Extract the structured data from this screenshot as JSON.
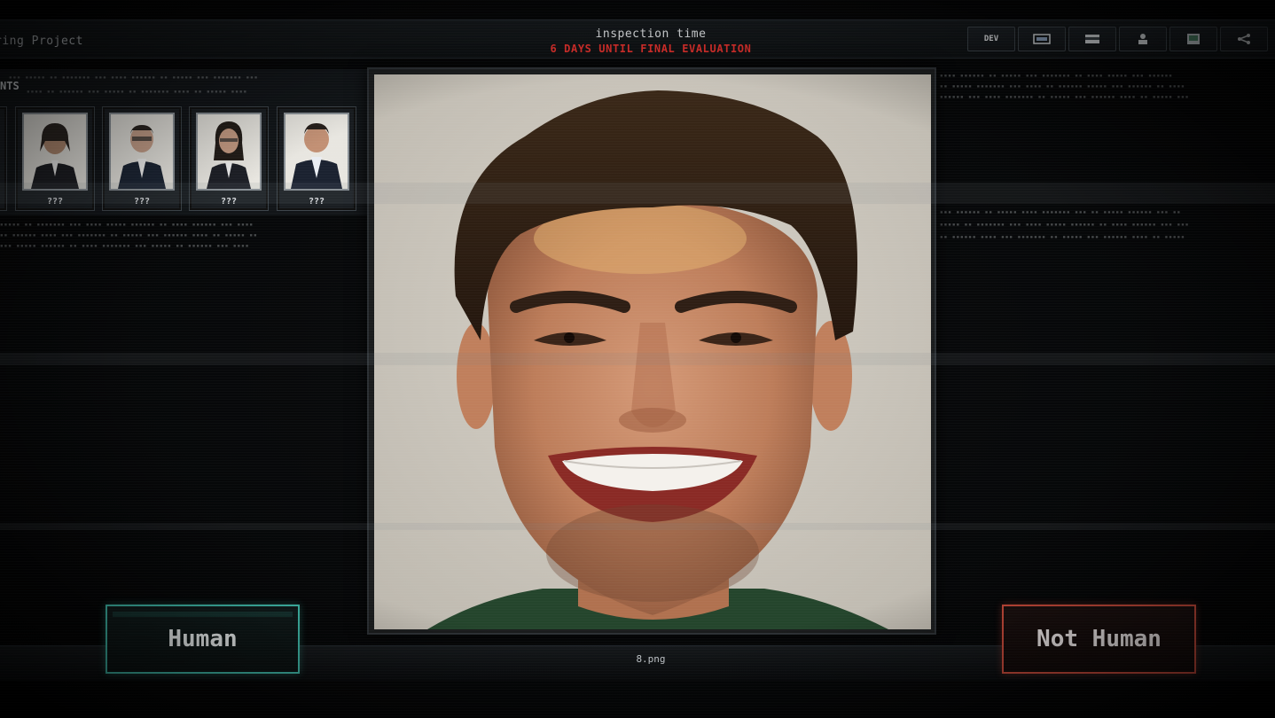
{
  "header": {
    "project_title": "ring Project",
    "title": "inspection time",
    "countdown": "6 DAYS UNTIL FINAL EVALUATION"
  },
  "toolbar": {
    "buttons": [
      {
        "label": "DEV",
        "icon": "dev-text"
      },
      {
        "label": "",
        "icon": "image-icon"
      },
      {
        "label": "",
        "icon": "card-icon"
      },
      {
        "label": "",
        "icon": "person-icon"
      },
      {
        "label": "",
        "icon": "picture-icon"
      },
      {
        "label": "",
        "icon": "share-icon"
      }
    ]
  },
  "applicants": {
    "title": "NTS",
    "cards": [
      {
        "label": "???"
      },
      {
        "label": "???"
      },
      {
        "label": "???"
      },
      {
        "label": "???"
      }
    ]
  },
  "inspection": {
    "filename": "8.png"
  },
  "actions": {
    "human_label": "Human",
    "not_human_label": "Not Human"
  },
  "colors": {
    "human_accent": "#3fb9a9",
    "not_human_accent": "#c94a3a",
    "countdown": "#e0302c"
  }
}
